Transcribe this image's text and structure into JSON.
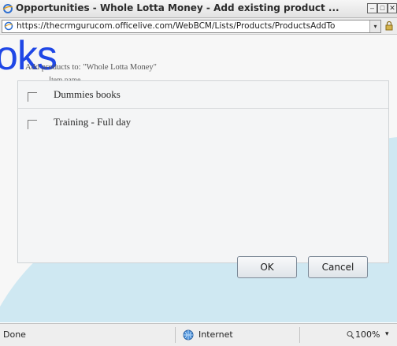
{
  "window": {
    "title": "Opportunities - Whole Lotta Money - Add existing product ...",
    "minimize_label": "–",
    "maximize_label": "□",
    "close_label": "✕"
  },
  "address": {
    "url": "https://thecrmgurucom.officelive.com/WebBCM/Lists/Products/ProductsAddTo",
    "dropdown_glyph": "▾"
  },
  "overlay": {
    "big_text": "oks"
  },
  "dialog": {
    "add_products_label": "Add products to: \"Whole Lotta Money\"",
    "column_header": "Item name",
    "items": [
      {
        "label": "Dummies books",
        "checked": false
      },
      {
        "label": "Training - Full day",
        "checked": false
      }
    ],
    "ok_label": "OK",
    "cancel_label": "Cancel"
  },
  "status": {
    "left": "Done",
    "zone": "Internet",
    "zoom": "100%",
    "zoom_dropdown": "▾"
  },
  "colors": {
    "blob": "#cfe8f2",
    "overlay_text": "#1f47e6"
  }
}
